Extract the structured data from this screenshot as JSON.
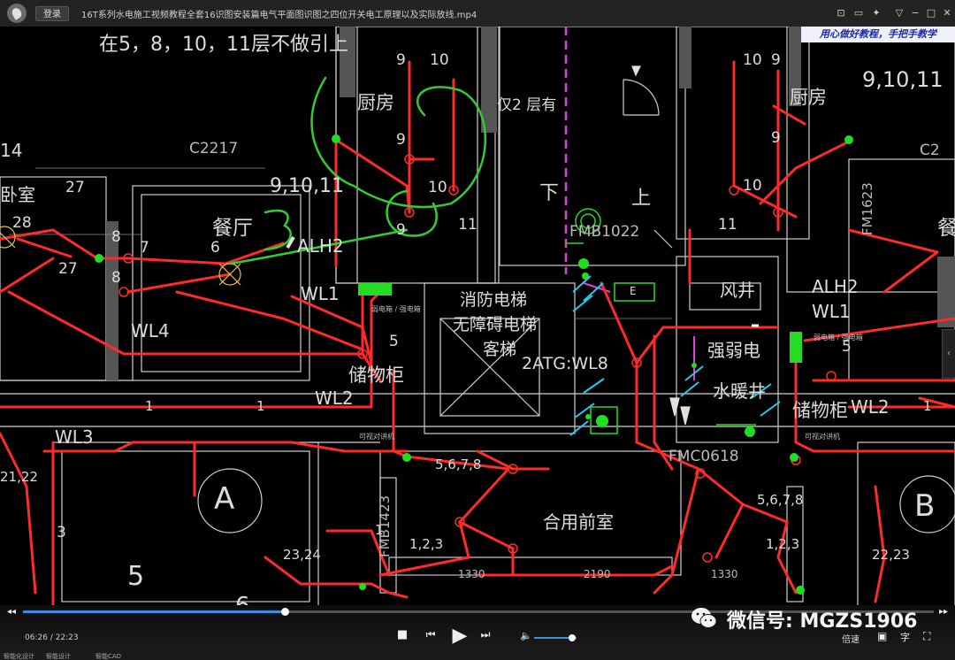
{
  "titlebar": {
    "login": "登录",
    "title": "16T系列水电施工视频教程全套16识图安装篇电气平面图识图之四位开关电工原理以及实际放线.mp4"
  },
  "cad": {
    "banner": "用心做好教程，手把手教学",
    "labels": {
      "note_top": "在5，8，10，11层不做引上",
      "kitchen_l": "厨房",
      "kitchen_r": "厨房",
      "only2": "仅2 层有",
      "floors_l": "9,10,11",
      "floors_r": "9,10,11",
      "dining_l": "餐厅",
      "dining_r": "餐",
      "down": "下",
      "up": "上",
      "fire_elevator": "消防电梯",
      "barrierfree": "无障碍电梯",
      "passenger": "客梯",
      "elev_code": "2ATG:WL8",
      "air_shaft": "风井",
      "weak_elec": "强弱电",
      "plumbing": "水暖井",
      "storage_l": "储物柜",
      "storage_r": "储物柜",
      "wl1_l": "WL1",
      "wl1_r": "WL1",
      "wl2_l": "WL2",
      "wl2_r": "WL2",
      "wl3": "WL3",
      "wl4": "WL4",
      "alh2_l": "ALH2",
      "alh2_r": "ALH2",
      "lobby": "合用前室",
      "circle_a": "A",
      "circle_b": "B",
      "fmb": "FMB1022",
      "fmc": "FMC0618",
      "fm_left": "FMB1423",
      "fm_right": "FM1623",
      "e_box": "E",
      "num_567_l": "5,6,7,8",
      "num_567_r": "5,6,7,8",
      "num_123_l": "1,2,3",
      "num_123_r": "1,2,3",
      "num_2324": "23,24",
      "num_2223": "22,23",
      "num_2122": "21,22",
      "c2217": "C2217",
      "c_r": "C2",
      "dim_1330_l": "1330",
      "dim_2190": "2190",
      "dim_1330_r": "1330",
      "room_left": "卧室",
      "n27a": "27",
      "n28": "28",
      "n27b": "27",
      "n8a": "8",
      "n8b": "8",
      "n7": "7",
      "n6": "6",
      "n5a": "5",
      "n5b": "5",
      "n5c": "5",
      "n6b": "6",
      "n9a": "9",
      "n10a": "10",
      "n9b": "9",
      "n10b": "10",
      "n9c": "9",
      "n11a": "11",
      "n10c": "10",
      "n9d": "9",
      "n9e": "9",
      "n10d": "10",
      "n11b": "11",
      "n1a": "1",
      "n1b": "1",
      "n1c": "1",
      "n1d": "1",
      "n3": "3",
      "n14": "14",
      "hand_3": "3",
      "intercom_l": "可视对讲机",
      "intercom_r": "可视对讲机",
      "box_l": "弱电箱 / 强电箱",
      "box_r": "弱电箱 / 强电箱"
    }
  },
  "player": {
    "time": "06:26 / 22:23",
    "progress": 0.287,
    "volume": 0.9,
    "speed": "倍速",
    "subtitle_icon": "字",
    "wechat": "微信号: MGZS1906"
  },
  "bottom_tabs": [
    "智能化设计",
    "智能设计",
    "智能CAD"
  ]
}
